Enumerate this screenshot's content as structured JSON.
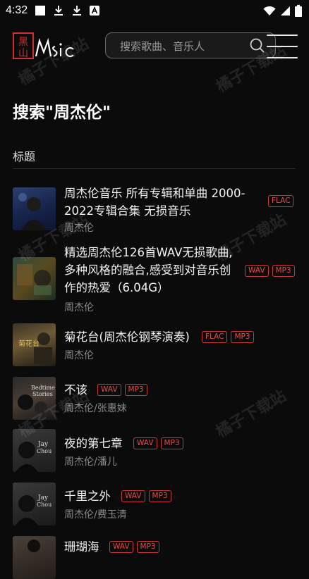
{
  "status_bar": {
    "time": "4:32"
  },
  "header": {
    "logo_text": "黑山Music",
    "search_placeholder": "搜索歌曲、音乐人"
  },
  "page": {
    "title": "搜索\"周杰伦\"",
    "section_label": "标题"
  },
  "results": [
    {
      "title_lines": [
        "周杰伦音乐 所有专辑和单曲 2000-",
        "2022专辑合集 无损音乐"
      ],
      "artist": "周杰伦",
      "badges": [
        "FLAC"
      ]
    },
    {
      "title_lines": [
        "精选周杰伦126首WAV无损歌曲,",
        "多种风格的融合,感受到对音乐创",
        "作的热爱（6.04G）"
      ],
      "artist": "周杰伦",
      "badges": [
        "WAV",
        "MP3"
      ]
    },
    {
      "title_lines": [
        "菊花台(周杰伦钢琴演奏)"
      ],
      "artist": "周杰伦",
      "badges": [
        "FLAC",
        "MP3"
      ]
    },
    {
      "title_lines": [
        "不该"
      ],
      "artist": "周杰伦/张惠妹",
      "badges": [
        "WAV",
        "MP3"
      ]
    },
    {
      "title_lines": [
        "夜的第七章"
      ],
      "artist": "周杰伦/潘儿",
      "badges": [
        "WAV",
        "MP3"
      ]
    },
    {
      "title_lines": [
        "千里之外"
      ],
      "artist": "周杰伦/费玉清",
      "badges": [
        "WAV",
        "MP3"
      ]
    },
    {
      "title_lines": [
        "珊瑚海"
      ],
      "artist": "",
      "badges": [
        "WAV",
        "MP3"
      ]
    }
  ],
  "watermark": "橘子下载站",
  "colors": {
    "accent": "#e84a4a",
    "background": "#0b0b0b"
  }
}
